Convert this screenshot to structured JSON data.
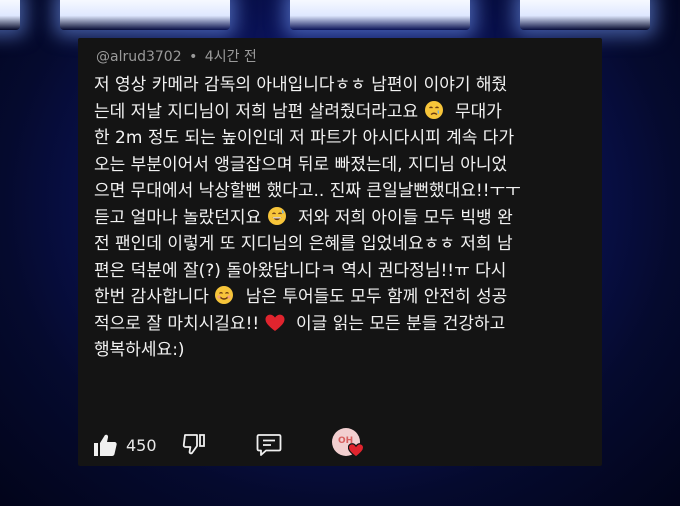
{
  "comment": {
    "username": "@alrud3702",
    "separator": "•",
    "time": "4시간 전",
    "lines": [
      "저 영상 카메라 감독의 아내입니다ㅎㅎ 남편이 이야기 해줬",
      "는데  저날 지디님이 저희 남편 살려줬더라고요",
      "무대가",
      "한 2m 정도 되는 높이인데 저 파트가 아시다시피 계속 다가",
      "오는 부분이어서 앵글잡으며 뒤로 빠졌는데, 지디님 아니었",
      "으면 무대에서 낙상할뻔 했다고.. 진짜 큰일날뻔했대요!!ㅜㅜ",
      "듣고 얼마나 놀랐던지요",
      "저와 저희 아이들 모두 빅뱅 완",
      "전 팬인데 이렇게 또 지디님의 은혜를 입었네요ㅎㅎ 저희 남",
      "편은 덕분에 잘(?) 돌아왔답니다ㅋ 역시 권다정님!!ㅠ 다시",
      "한번 감사합니다",
      "남은 투어들도 모두 함께 안전히 성공",
      "적으로 잘 마치시길요!!",
      "이글 읽는 모든 분들 건강하고",
      "행복하세요:)"
    ],
    "emojis": [
      "crying-face",
      "sweat-smile-face",
      "smiling-face",
      "red-heart"
    ],
    "likes": "450",
    "creator_avatar_text": "OH"
  },
  "colors": {
    "card_bg": "#141414",
    "text": "#f2f2f2",
    "meta": "#9a9a9a",
    "heart": "#e0242e",
    "background": "#0b1460"
  }
}
